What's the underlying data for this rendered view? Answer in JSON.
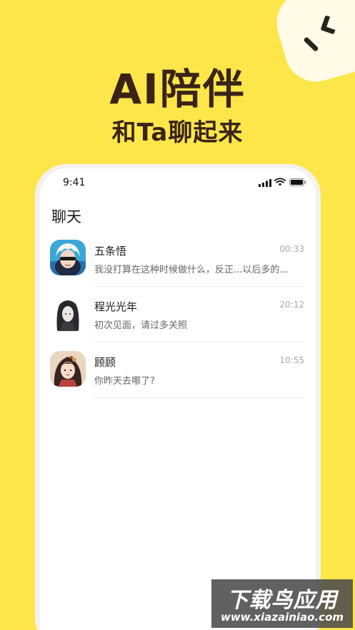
{
  "hero": {
    "title": "AI陪伴",
    "subtitle": "和Ta聊起来"
  },
  "status_bar": {
    "time": "9:41"
  },
  "page": {
    "title": "聊天"
  },
  "chats": [
    {
      "name": "五条悟",
      "time": "00:33",
      "preview": "我没打算在这种时候做什么，反正...以后多的...",
      "avatar": "avatar-white-hair-blindfold"
    },
    {
      "name": "程光光年",
      "time": "20:12",
      "preview": "初次见面，请过多关照",
      "avatar": "avatar-dark-long-hair"
    },
    {
      "name": "顾顾",
      "time": "10:55",
      "preview": "你昨天去哪了?",
      "avatar": "avatar-ancient-style-girl"
    }
  ],
  "watermark": {
    "title": "下载鸟应用",
    "url": "www.xiazainiao.com"
  },
  "colors": {
    "background": "#FCE64A",
    "title_text": "#3a2418",
    "card": "#FFFFFF"
  }
}
